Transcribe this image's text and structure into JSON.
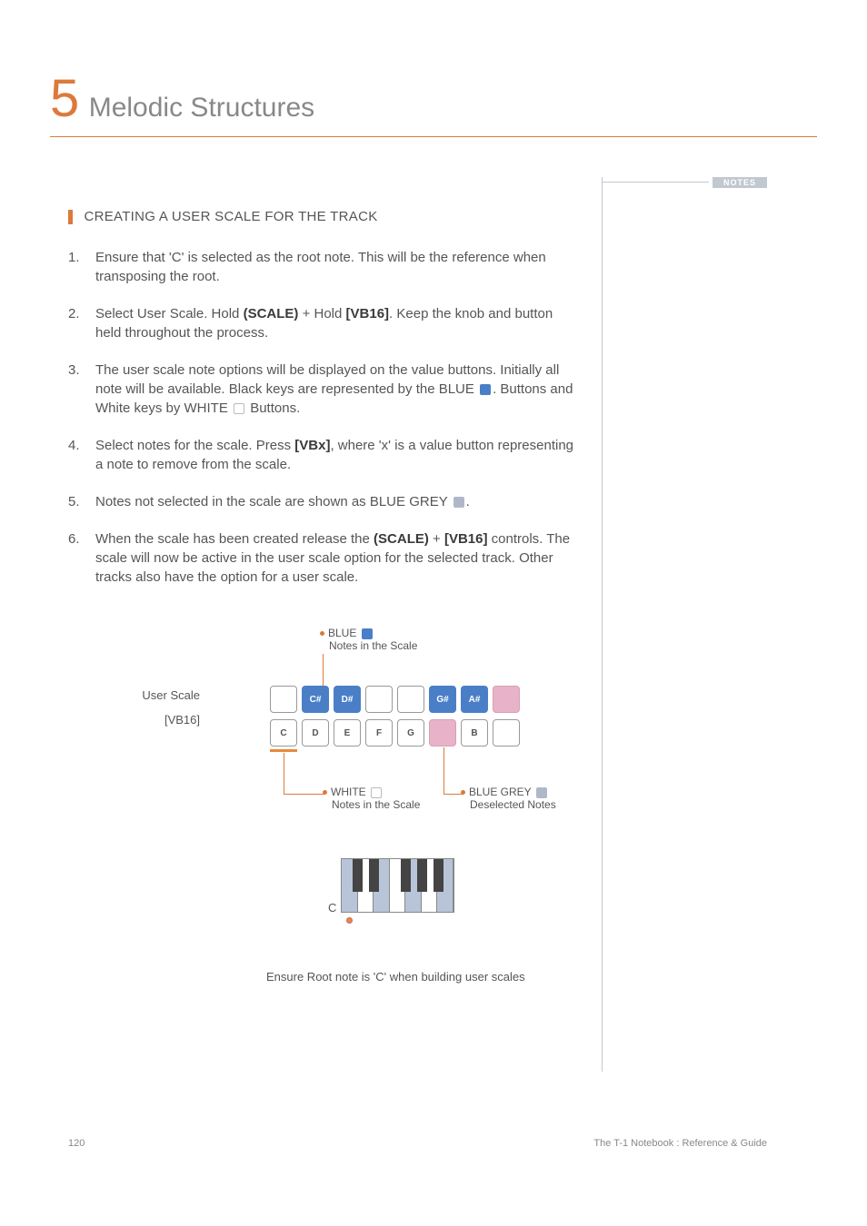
{
  "chapter": {
    "num": "5",
    "title": "Melodic Structures"
  },
  "notes_tab": "NOTES",
  "section_title": "CREATING A USER SCALE FOR THE TRACK",
  "steps": {
    "s1": "Ensure that 'C' is selected as the root note. This will be the reference when transposing the root.",
    "s2a": "Select User Scale. Hold ",
    "s2b": "(SCALE)",
    "s2c": " + Hold ",
    "s2d": "[VB16]",
    "s2e": ". Keep the knob and button held throughout the process.",
    "s3a": "The user scale note options will be displayed on the value buttons. Initially all note will be available. Black keys are represented by the BLUE ",
    "s3b": ". Buttons and White keys by WHITE ",
    "s3c": " Buttons.",
    "s4a": "Select notes for the scale. Press ",
    "s4b": "[VBx]",
    "s4c": ", where 'x' is a value button representing a note to remove from the scale.",
    "s5a": "Notes not selected in the scale are shown as BLUE GREY ",
    "s5b": ".",
    "s6a": "When the scale has been created release the ",
    "s6b": "(SCALE)",
    "s6c": " + ",
    "s6d": "[VB16]",
    "s6e": " controls. The scale will now be active in the user scale option for the selected track. Other tracks also have the option for a user scale."
  },
  "diagram": {
    "left_label1": "User Scale",
    "left_label2": "[VB16]",
    "callout_blue_t": "BLUE",
    "callout_blue_s": "Notes in the Scale",
    "callout_white_t": "WHITE",
    "callout_white_s": "Notes in the Scale",
    "callout_grey_t": "BLUE GREY",
    "callout_grey_s": "Deselected Notes",
    "top_row": [
      {
        "label": "",
        "cls": "blank"
      },
      {
        "label": "C#",
        "cls": "blue"
      },
      {
        "label": "D#",
        "cls": "blue"
      },
      {
        "label": "",
        "cls": "blank"
      },
      {
        "label": "",
        "cls": "blank"
      },
      {
        "label": "G#",
        "cls": "blue"
      },
      {
        "label": "A#",
        "cls": "blue"
      },
      {
        "label": "",
        "cls": "grey"
      }
    ],
    "bot_row": [
      {
        "label": "C",
        "cls": "white"
      },
      {
        "label": "D",
        "cls": "white"
      },
      {
        "label": "E",
        "cls": "white"
      },
      {
        "label": "F",
        "cls": "white"
      },
      {
        "label": "G",
        "cls": "white"
      },
      {
        "label": "",
        "cls": "grey"
      },
      {
        "label": "B",
        "cls": "white"
      },
      {
        "label": "",
        "cls": "blank"
      }
    ],
    "mini_c": "C",
    "caption": "Ensure Root note is 'C' when building user scales"
  },
  "footer": {
    "page": "120",
    "ref": "The T-1 Notebook : Reference & Guide"
  }
}
